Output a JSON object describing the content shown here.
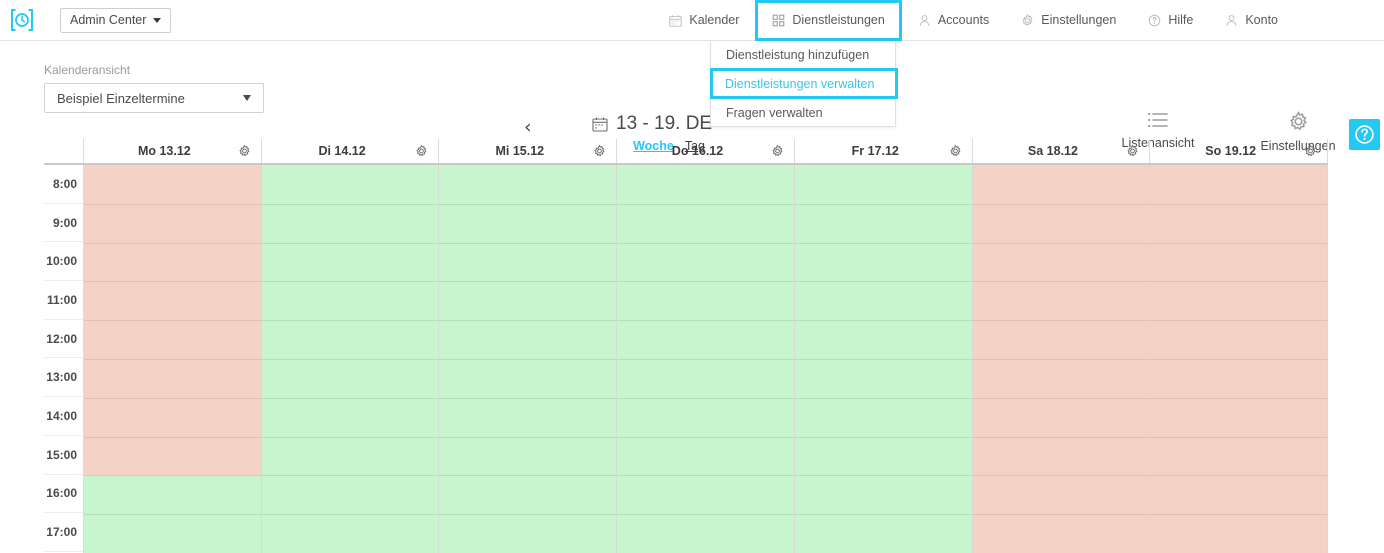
{
  "topbar": {
    "logo_icon": "clock-bracket-logo",
    "admin_select": {
      "label": "Admin Center",
      "icon": "chevron-down-icon"
    },
    "nav": [
      {
        "label": "Kalender",
        "icon": "calendar-icon",
        "active": false
      },
      {
        "label": "Dienstleistungen",
        "icon": "grid-icon",
        "active": true
      },
      {
        "label": "Accounts",
        "icon": "user-icon",
        "active": false
      },
      {
        "label": "Einstellungen",
        "icon": "gear-icon",
        "active": false
      },
      {
        "label": "Hilfe",
        "icon": "question-icon",
        "active": false
      },
      {
        "label": "Konto",
        "icon": "user-icon",
        "active": false
      }
    ]
  },
  "dropdown": {
    "items": [
      {
        "label": "Dienstleistung hinzufügen",
        "highlighted": false
      },
      {
        "label": "Dienstleistungen verwalten",
        "highlighted": true
      },
      {
        "label": "Fragen verwalten",
        "highlighted": false
      }
    ]
  },
  "controls": {
    "calendar_view_label": "Kalenderansicht",
    "calendar_view_value": "Beispiel Einzeltermine",
    "prev_arrow": "‹",
    "date_range": "13 - 19. DE",
    "date_icon": "calendar-icon",
    "range_links": [
      {
        "label": "Woche",
        "active": true
      },
      {
        "label": "Tag",
        "active": false
      }
    ],
    "tools": [
      {
        "label": "Listenansicht",
        "icon": "list-icon"
      },
      {
        "label": "Einstellungen",
        "icon": "gear-icon"
      }
    ],
    "help_button": {
      "icon": "question-circle-icon",
      "color": "#22c9f2"
    }
  },
  "calendar": {
    "days": [
      {
        "label": "Mo 13.12",
        "gear": "gear-icon"
      },
      {
        "label": "Di 14.12",
        "gear": "gear-icon"
      },
      {
        "label": "Mi 15.12",
        "gear": "gear-icon"
      },
      {
        "label": "Do 16.12",
        "gear": "gear-icon"
      },
      {
        "label": "Fr 17.12",
        "gear": "gear-icon"
      },
      {
        "label": "Sa 18.12",
        "gear": "gear-icon"
      },
      {
        "label": "So 19.12",
        "gear": "gear-icon"
      }
    ],
    "times": [
      "8:00",
      "9:00",
      "10:00",
      "11:00",
      "12:00",
      "13:00",
      "14:00",
      "15:00",
      "16:00",
      "17:00"
    ],
    "colors": {
      "unavailable": "#f5d2c6",
      "available": "#c6f5ce"
    },
    "availability": [
      {
        "day": "Mo 13.12",
        "segments": [
          {
            "from": "8:00",
            "to": "16:00",
            "state": "unavailable"
          },
          {
            "from": "16:00",
            "to": "18:00",
            "state": "available"
          }
        ]
      },
      {
        "day": "Di 14.12",
        "segments": [
          {
            "from": "8:00",
            "to": "18:00",
            "state": "available"
          }
        ]
      },
      {
        "day": "Mi 15.12",
        "segments": [
          {
            "from": "8:00",
            "to": "18:00",
            "state": "available"
          }
        ]
      },
      {
        "day": "Do 16.12",
        "segments": [
          {
            "from": "8:00",
            "to": "18:00",
            "state": "available"
          }
        ]
      },
      {
        "day": "Fr 17.12",
        "segments": [
          {
            "from": "8:00",
            "to": "18:00",
            "state": "available"
          }
        ]
      },
      {
        "day": "Sa 18.12",
        "segments": [
          {
            "from": "8:00",
            "to": "18:00",
            "state": "unavailable"
          }
        ]
      },
      {
        "day": "So 19.12",
        "segments": [
          {
            "from": "8:00",
            "to": "18:00",
            "state": "unavailable"
          }
        ]
      }
    ]
  }
}
